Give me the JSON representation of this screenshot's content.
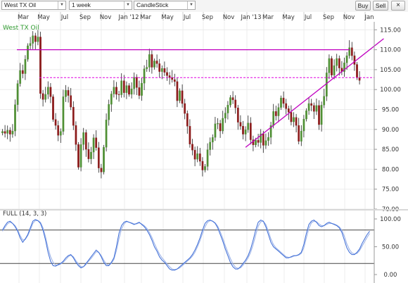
{
  "toolbar": {
    "symbol": "West TX Oil",
    "interval": "1 week",
    "chart_type": "CandleStick",
    "buy_label": "Buy",
    "sell_label": "Sell",
    "close_symbol": "×"
  },
  "colors": {
    "up": "#4f8f34",
    "down": "#8b1a1a",
    "trendline": "#c000c0",
    "support": "#e000e0",
    "stoch_k": "#3b6bd6",
    "stoch_d": "#9bb2e8",
    "title": "#2e9a2e"
  },
  "time_axis": {
    "labels": [
      "Mar",
      "May",
      "Jul",
      "Sep",
      "Nov",
      "Jan '12",
      "Mar",
      "May",
      "Jul",
      "Sep",
      "Nov",
      "Jan '13",
      "Mar",
      "May",
      "Jul",
      "Sep",
      "Nov",
      "Jan"
    ]
  },
  "chart_data": [
    {
      "type": "candlestick",
      "title": "West TX Oil",
      "ylim": [
        70,
        117
      ],
      "yticks": [
        "115.00",
        "110.00",
        "105.00",
        "100.00",
        "95.00",
        "90.00",
        "85.00",
        "80.00",
        "75.00",
        "70.00"
      ],
      "ytick_values": [
        115,
        110,
        105,
        100,
        95,
        90,
        85,
        80,
        75,
        70
      ],
      "closes": [
        89.5,
        89.0,
        89.8,
        88.8,
        89.6,
        96.2,
        101.5,
        104.8,
        104.0,
        107.6,
        111.0,
        111.6,
        113.5,
        112.0,
        113.2,
        99.0,
        97.5,
        98.8,
        100.6,
        98.2,
        92.5,
        91.0,
        88.5,
        89.5,
        98.2,
        99.8,
        98.5,
        95.6,
        91.0,
        86.2,
        80.5,
        86.2,
        89.2,
        85.0,
        82.6,
        84.3,
        87.9,
        85.4,
        80.3,
        79.3,
        85.5,
        92.4,
        96.3,
        98.9,
        100.6,
        98.8,
        98.7,
        102.2,
        99.2,
        101.0,
        98.8,
        100.2,
        103.1,
        100.5,
        98.5,
        101.6,
        105.2,
        105.6,
        108.8,
        105.6,
        107.2,
        106.5,
        104.5,
        105.3,
        104.3,
        103.5,
        103.0,
        102.5,
        102.0,
        97.2,
        99.7,
        96.5,
        94.0,
        90.8,
        86.3,
        84.8,
        82.5,
        83.9,
        82.0,
        79.8,
        80.7,
        84.9,
        86.8,
        88.0,
        91.4,
        91.5,
        89.6,
        92.8,
        94.1,
        96.1,
        98.0,
        97.4,
        95.4,
        91.8,
        90.8,
        88.8,
        89.9,
        91.6,
        87.4,
        86.1,
        87.3,
        86.7,
        88.9,
        86.0,
        87.2,
        88.0,
        91.0,
        94.5,
        93.4,
        95.5,
        97.9,
        96.5,
        95.2,
        94.3,
        91.9,
        93.0,
        91.0,
        87.0,
        89.6,
        92.6,
        94.7,
        96.5,
        96.0,
        94.5,
        96.0,
        91.2,
        96.1,
        98.3,
        104.2,
        107.8,
        103.6,
        106.0,
        107.8,
        105.4,
        104.5,
        106.7,
        108.5,
        110.5,
        108.5,
        106.3,
        103.0,
        102.3
      ],
      "annotations": {
        "horizontal_resistance": 110.0,
        "horizontal_support_dashed": 103.0,
        "rising_trendline": {
          "from": {
            "week": 96,
            "price": 85.5
          },
          "to": {
            "week": 145,
            "price": 110.0
          }
        }
      }
    },
    {
      "type": "line",
      "title": "FULL (14, 3, 3)",
      "ylim": [
        0,
        100
      ],
      "yticks": [
        "100.00",
        "50.00",
        "0.00"
      ],
      "ytick_values": [
        100,
        50,
        0
      ],
      "levels": [
        80,
        20
      ],
      "series": [
        {
          "values": [
            80,
            88,
            94,
            96,
            92,
            86,
            78,
            66,
            58,
            64,
            72,
            84,
            96,
            99,
            97,
            92,
            80,
            62,
            40,
            24,
            16,
            15,
            18,
            20,
            24,
            30,
            34,
            36,
            30,
            22,
            16,
            12,
            14,
            20,
            26,
            32,
            38,
            44,
            40,
            32,
            22,
            16,
            16,
            22,
            30,
            50,
            74,
            88,
            94,
            96,
            94,
            92,
            90,
            92,
            94,
            90,
            86,
            80,
            72,
            62,
            50,
            42,
            32,
            26,
            22,
            16,
            10,
            8,
            8,
            10,
            14,
            18,
            22,
            26,
            30,
            36,
            44,
            54,
            66,
            80,
            92,
            97,
            98,
            96,
            92,
            84,
            72,
            60,
            46,
            34,
            22,
            14,
            10,
            10,
            14,
            20,
            26,
            34,
            46,
            62,
            80,
            94,
            98,
            96,
            86,
            72,
            58,
            50,
            46,
            42,
            38,
            34,
            30,
            30,
            32,
            34,
            34,
            36,
            40,
            54,
            74,
            90,
            96,
            98,
            94,
            88,
            86,
            88,
            92,
            94,
            92,
            90,
            88,
            84,
            76,
            62,
            48,
            40,
            36,
            36,
            40,
            46,
            56,
            64,
            72,
            78
          ]
        },
        {
          "values": [
            78,
            85,
            91,
            94,
            92,
            88,
            80,
            70,
            62,
            63,
            70,
            80,
            92,
            97,
            97,
            94,
            84,
            68,
            48,
            32,
            22,
            17,
            17,
            19,
            22,
            27,
            32,
            35,
            32,
            25,
            19,
            14,
            14,
            18,
            24,
            29,
            35,
            41,
            40,
            34,
            26,
            19,
            17,
            20,
            27,
            43,
            64,
            82,
            91,
            95,
            94,
            93,
            91,
            91,
            93,
            91,
            88,
            83,
            76,
            67,
            56,
            46,
            37,
            30,
            25,
            19,
            14,
            10,
            9,
            10,
            12,
            16,
            20,
            24,
            28,
            33,
            40,
            50,
            61,
            74,
            86,
            94,
            97,
            96,
            93,
            87,
            77,
            65,
            52,
            40,
            29,
            19,
            13,
            11,
            12,
            17,
            23,
            30,
            40,
            54,
            71,
            87,
            95,
            96,
            90,
            78,
            64,
            54,
            48,
            44,
            40,
            36,
            32,
            31,
            31,
            33,
            34,
            35,
            38,
            48,
            66,
            83,
            93,
            96,
            95,
            91,
            88,
            88,
            90,
            92,
            92,
            91,
            89,
            86,
            80,
            69,
            55,
            45,
            39,
            37,
            38,
            43,
            51,
            59,
            67,
            74
          ]
        }
      ]
    }
  ]
}
